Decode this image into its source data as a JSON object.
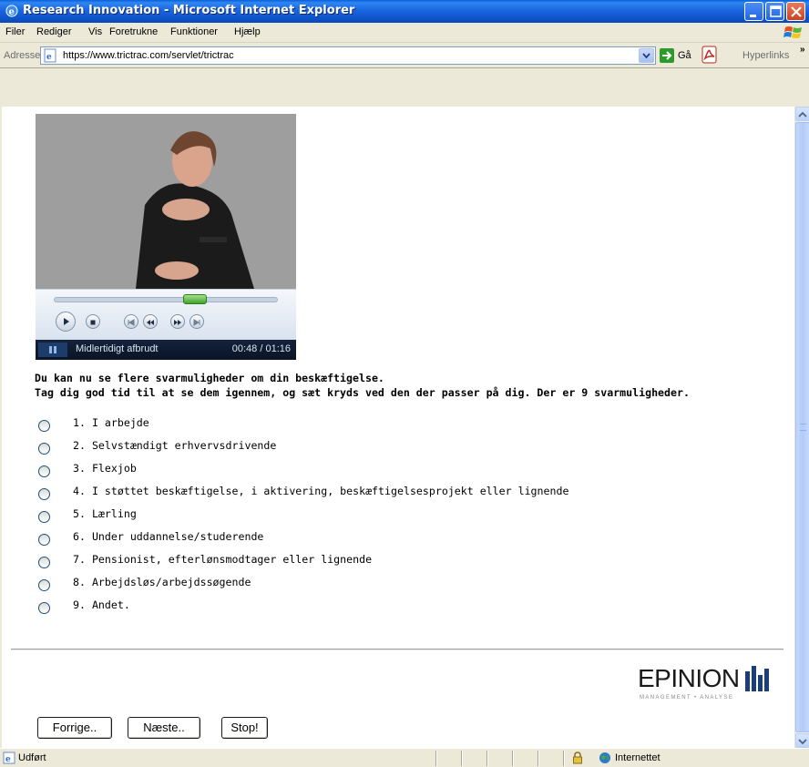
{
  "window": {
    "title": "Research Innovation - Microsoft Internet Explorer"
  },
  "menu": {
    "items": [
      "Filer",
      "Rediger",
      "Vis",
      "Foretrukne",
      "Funktioner",
      "Hjælp"
    ]
  },
  "address": {
    "label": "Adresse",
    "url": "https://www.trictrac.com/servlet/trictrac",
    "go_label": "Gå",
    "links_label": "Hyperlinks"
  },
  "player": {
    "state": "Midlertidigt afbrudt",
    "time": "00:48 / 01:16",
    "progress": 0.63
  },
  "question": {
    "line1": "Du kan nu se flere svarmuligheder om din beskæftigelse.",
    "line2": "Tag dig god tid til at se dem igennem, og sæt kryds ved den der passer på dig. Der er 9 svarmuligheder."
  },
  "options": [
    "1. I arbejde",
    "2. Selvstændigt erhvervsdrivende",
    "3. Flexjob",
    "4. I støttet beskæftigelse, i aktivering, beskæftigelsesprojekt eller lignende",
    "5. Lærling",
    "6. Under uddannelse/studerende",
    "7. Pensionist, efterlønsmodtager eller lignende",
    "8. Arbejdsløs/arbejdssøgende",
    "9. Andet."
  ],
  "logo": {
    "name": "EPINION",
    "tagline": "MANAGEMENT • ANALYSE"
  },
  "buttons": {
    "previous": "Forrige..",
    "next": "Næste..",
    "stop": "Stop!"
  },
  "status": {
    "text": "Udført",
    "zone": "Internettet"
  },
  "colors": {
    "titlebar": "#0f53c9",
    "background": "#ece9d8",
    "seek_thumb": "#3ea52c"
  }
}
